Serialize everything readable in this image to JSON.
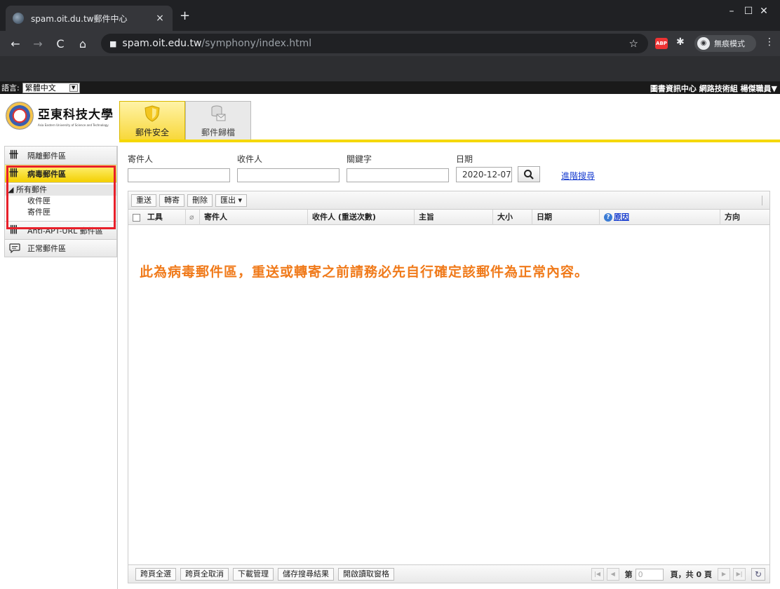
{
  "browser": {
    "tab_title": "spam.oit.du.tw郵件中心",
    "tab_close": "×",
    "new_tab": "+",
    "url_host": "spam.oit.edu.tw",
    "url_path": "/symphony/index.html",
    "incognito_label": "無痕模式",
    "abp_label": "ABP",
    "minimize": "–",
    "maximize": "☐",
    "close": "✕"
  },
  "header": {
    "lang_label": "語言:",
    "lang_value": "繁體中文",
    "user_info": "圖書資訊中心 網路技術組 楊傑職員▼"
  },
  "logo": {
    "name_cn": "亞東科技大學",
    "name_en": "Asia Eastern University of Science and Technology"
  },
  "modules": [
    {
      "label": "郵件安全",
      "active": true
    },
    {
      "label": "郵件歸檔",
      "active": false
    }
  ],
  "sidebar": {
    "items": [
      {
        "label": "隔離郵件區"
      },
      {
        "label": "病毒郵件區"
      },
      {
        "label": "Anti-APT-URL 郵件區"
      },
      {
        "label": "正常郵件區"
      }
    ],
    "tree_root": "◢ 所有郵件",
    "tree_children": [
      "收件匣",
      "寄件匣"
    ]
  },
  "search": {
    "sender_label": "寄件人",
    "recipient_label": "收件人",
    "keyword_label": "關鍵字",
    "date_label": "日期",
    "date_value": "2020-12-07",
    "advanced_link": "進階搜尋"
  },
  "grid": {
    "toolbar": [
      "重送",
      "轉寄",
      "刪除",
      "匯出 ▾"
    ],
    "columns": [
      "工具",
      "寄件人",
      "收件人 (重送次數)",
      "主旨",
      "大小",
      "日期",
      "原因",
      "方向"
    ],
    "warning": "此為病毒郵件區，重送或轉寄之前請務必先自行確定該郵件為正常內容。",
    "footer_buttons": [
      "跨頁全選",
      "跨頁全取消",
      "下載管理",
      "儲存搜尋結果",
      "開啟讀取窗格"
    ],
    "pager": {
      "page_label": "第",
      "page_value": "0",
      "total_label": "頁，共 0 頁"
    }
  },
  "colors": {
    "accent_yellow": "#f5d800",
    "warning_orange": "#f07a1a",
    "highlight_red": "#e8202a",
    "link_blue": "#1a3fd0"
  }
}
